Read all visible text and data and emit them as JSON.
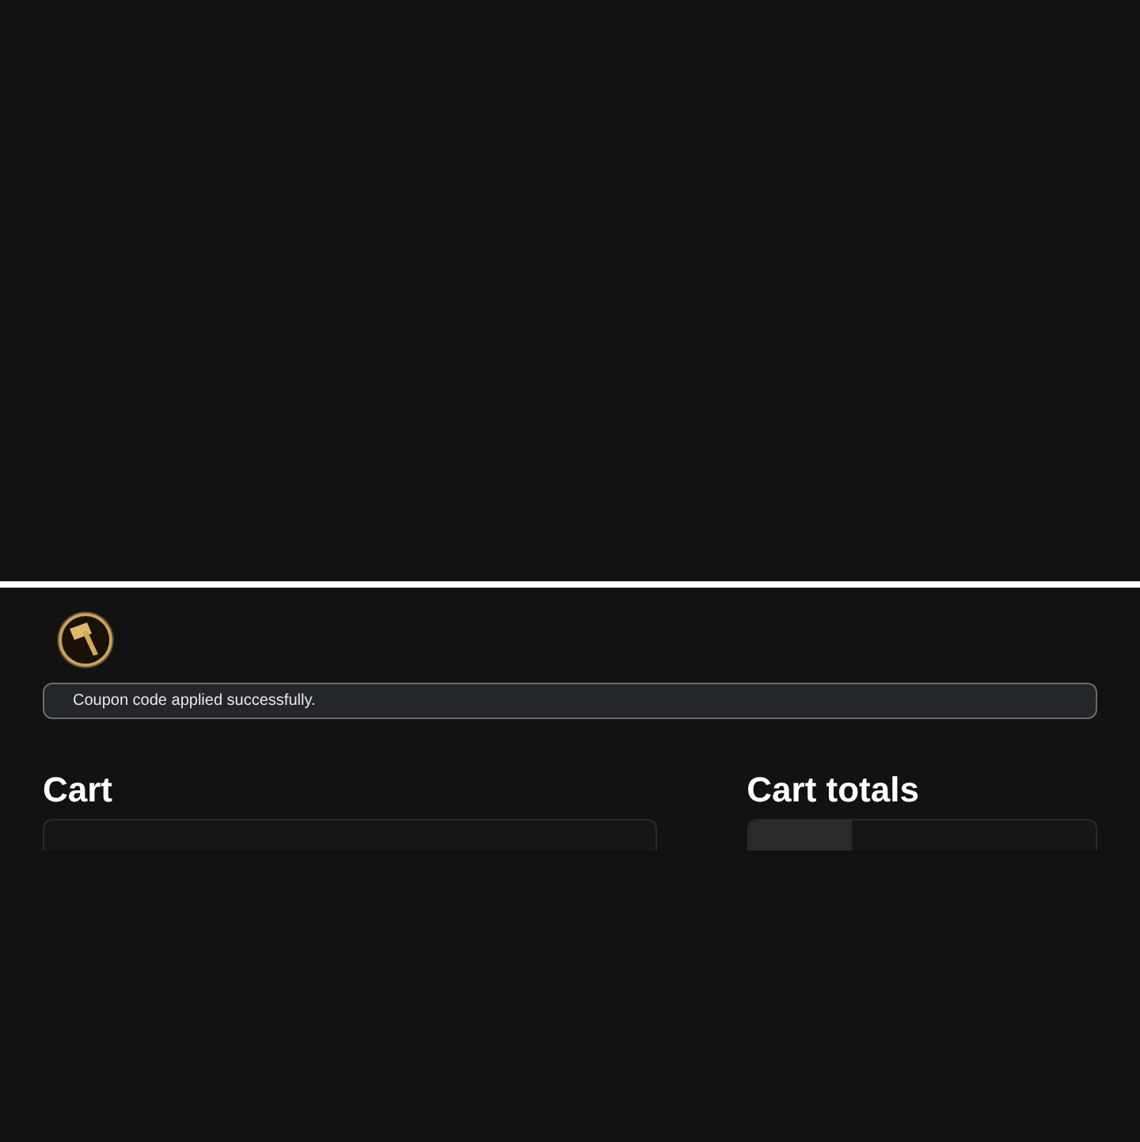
{
  "notice": {
    "text": "Coupon code applied successfully."
  },
  "cart": {
    "title": "Cart"
  },
  "cart_totals": {
    "title": "Cart totals"
  }
}
